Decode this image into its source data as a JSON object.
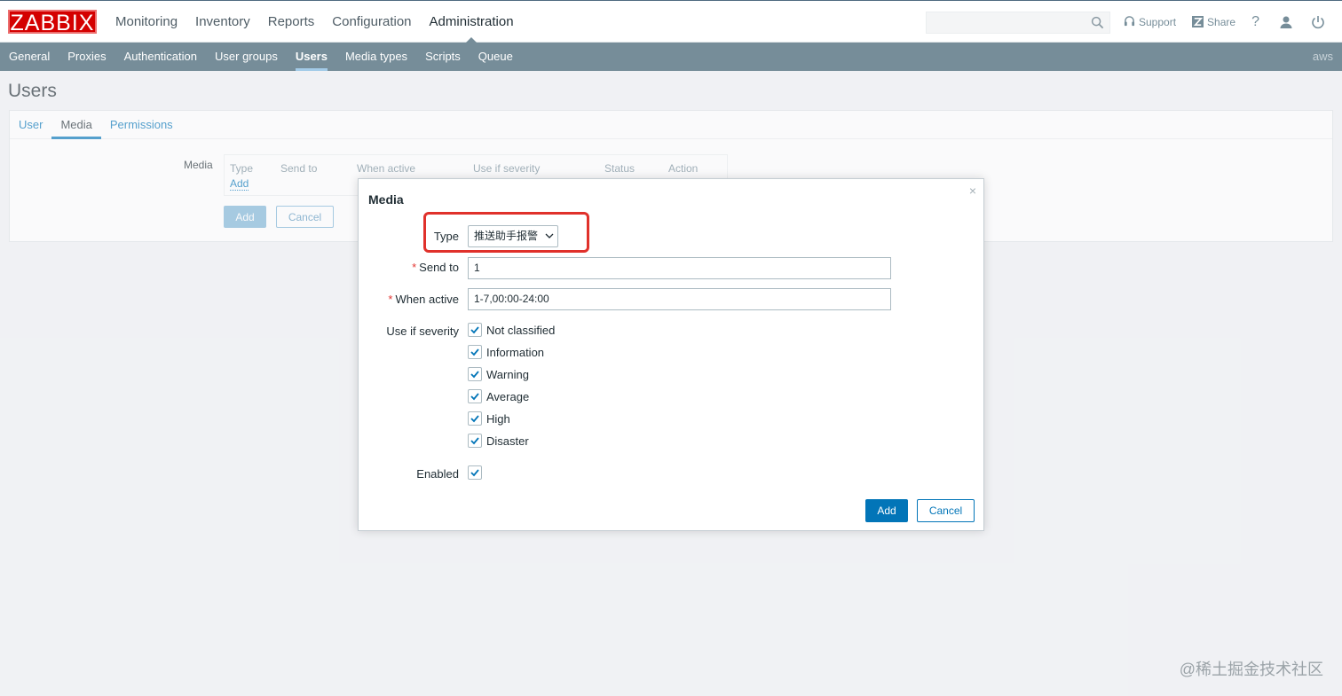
{
  "header": {
    "logo": "ZABBIX",
    "main_menu": [
      "Monitoring",
      "Inventory",
      "Reports",
      "Configuration",
      "Administration"
    ],
    "active_main": "Administration",
    "search_value": "",
    "support_label": "Support",
    "share_label": "Share",
    "help_label": "?"
  },
  "subnav": {
    "items": [
      "General",
      "Proxies",
      "Authentication",
      "User groups",
      "Users",
      "Media types",
      "Scripts",
      "Queue"
    ],
    "active": "Users",
    "server": "aws"
  },
  "page": {
    "title": "Users",
    "tabs": [
      "User",
      "Media",
      "Permissions"
    ],
    "active_tab": "Media",
    "media_label": "Media",
    "media_columns": [
      "Type",
      "Send to",
      "When active",
      "Use if severity",
      "Status",
      "Action"
    ],
    "add_link": "Add",
    "add_button": "Add",
    "cancel_button": "Cancel"
  },
  "dialog": {
    "title": "Media",
    "close_symbol": "×",
    "type_label": "Type",
    "type_value": "推送助手报警",
    "send_to_label": "Send to",
    "send_to_value": "1",
    "when_active_label": "When active",
    "when_active_value": "1-7,00:00-24:00",
    "severity_label": "Use if severity",
    "severities": [
      {
        "label": "Not classified",
        "checked": true
      },
      {
        "label": "Information",
        "checked": true
      },
      {
        "label": "Warning",
        "checked": true
      },
      {
        "label": "Average",
        "checked": true
      },
      {
        "label": "High",
        "checked": true
      },
      {
        "label": "Disaster",
        "checked": true
      }
    ],
    "enabled_label": "Enabled",
    "enabled_checked": true,
    "add_button": "Add",
    "cancel_button": "Cancel",
    "required_mark": "*"
  },
  "watermark": "@稀土掘金技术社区",
  "colors": {
    "brand_red": "#d40000",
    "accent_blue": "#0275b8",
    "subnav_bg": "#768d99",
    "highlight_red": "#e0312b"
  }
}
